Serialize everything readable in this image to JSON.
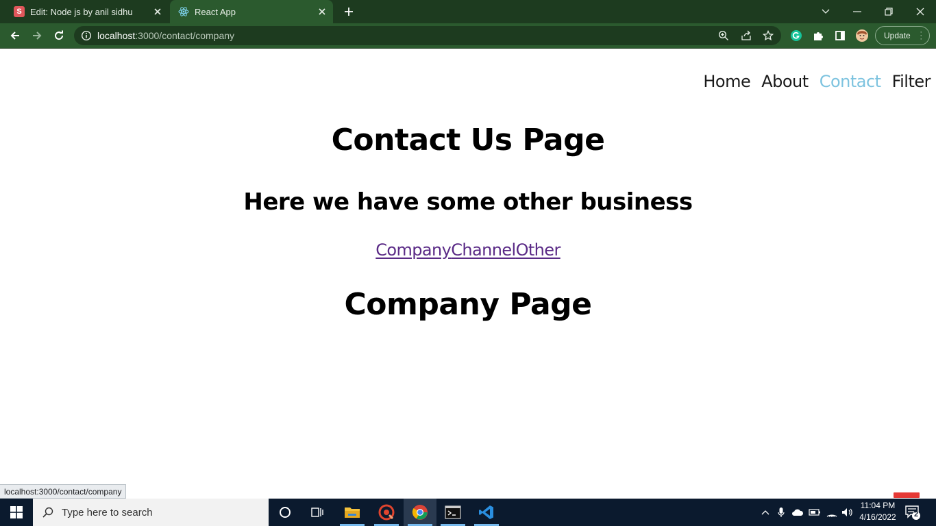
{
  "browser": {
    "tabs": [
      {
        "title": "Edit: Node js by anil sidhu",
        "favicon_letter": "S",
        "active": false
      },
      {
        "title": "React App",
        "favicon": "react-icon",
        "active": true
      }
    ],
    "url_host": "localhost",
    "url_rest": ":3000/contact/company",
    "update_label": "Update",
    "status_url": "localhost:3000/contact/company"
  },
  "nav": {
    "items": [
      "Home",
      "About",
      "Contact",
      "Filter"
    ],
    "active": "Contact",
    "active_color": "#7dc3df"
  },
  "content": {
    "title": "Contact Us Page",
    "subtitle": "Here we have some other business",
    "links": [
      "Company",
      "Channel",
      "Other"
    ],
    "link_color": "#5a2a86",
    "section_title": "Company Page"
  },
  "taskbar": {
    "search_placeholder": "Type here to search",
    "time": "11:04 PM",
    "date": "4/16/2022",
    "notification_count": "2"
  },
  "colors": {
    "chrome_dark": "#1d3b1f",
    "chrome_toolbar": "#2b5a2e",
    "taskbar": "#0b1a2e"
  }
}
